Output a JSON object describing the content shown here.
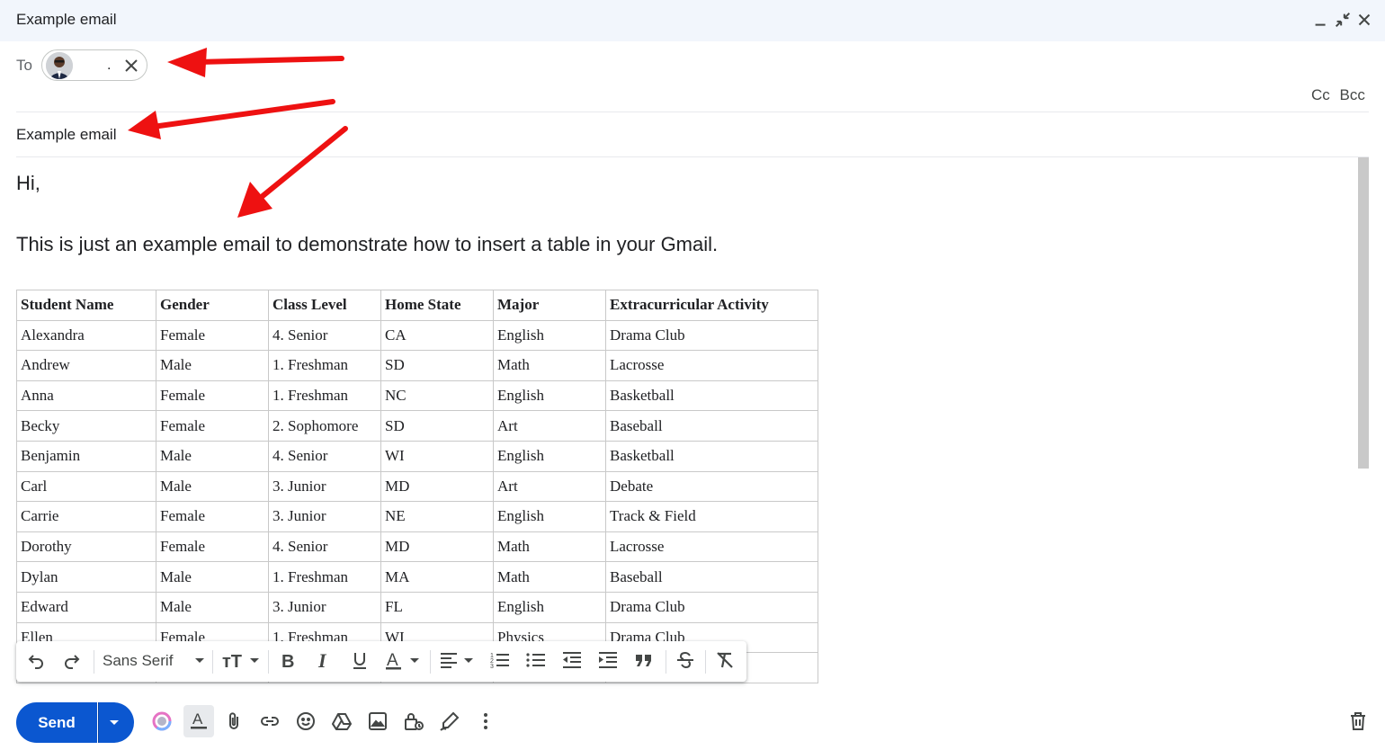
{
  "window": {
    "title": "Example email"
  },
  "recipients": {
    "to_label": "To",
    "chip_name": "."
  },
  "cc_label": "Cc",
  "bcc_label": "Bcc",
  "subject": "Example email",
  "body": {
    "greeting": "Hi,",
    "paragraph": "This is just an example email to demonstrate how to insert a table in your Gmail."
  },
  "table": {
    "headers": [
      "Student Name",
      "Gender",
      "Class Level",
      "Home State",
      "Major",
      "Extracurricular Activity"
    ],
    "rows": [
      [
        "Alexandra",
        "Female",
        "4. Senior",
        "CA",
        "English",
        "Drama Club"
      ],
      [
        "Andrew",
        "Male",
        "1. Freshman",
        "SD",
        "Math",
        "Lacrosse"
      ],
      [
        "Anna",
        "Female",
        "1. Freshman",
        "NC",
        "English",
        "Basketball"
      ],
      [
        "Becky",
        "Female",
        "2. Sophomore",
        "SD",
        "Art",
        "Baseball"
      ],
      [
        "Benjamin",
        "Male",
        "4. Senior",
        "WI",
        "English",
        "Basketball"
      ],
      [
        "Carl",
        "Male",
        "3. Junior",
        "MD",
        "Art",
        "Debate"
      ],
      [
        "Carrie",
        "Female",
        "3. Junior",
        "NE",
        "English",
        "Track & Field"
      ],
      [
        "Dorothy",
        "Female",
        "4. Senior",
        "MD",
        "Math",
        "Lacrosse"
      ],
      [
        "Dylan",
        "Male",
        "1. Freshman",
        "MA",
        "Math",
        "Baseball"
      ],
      [
        "Edward",
        "Male",
        "3. Junior",
        "FL",
        "English",
        "Drama Club"
      ],
      [
        "Ellen",
        "Female",
        "1. Freshman",
        "WI",
        "Physics",
        "Drama Club"
      ],
      [
        "",
        "",
        "",
        "",
        "",
        ""
      ]
    ]
  },
  "toolbar": {
    "font": "Sans Serif"
  },
  "send": {
    "label": "Send"
  },
  "colors": {
    "send_blue": "#0b57d0",
    "arrow_red": "#ee1111",
    "title_bar": "#f2f6fc"
  }
}
